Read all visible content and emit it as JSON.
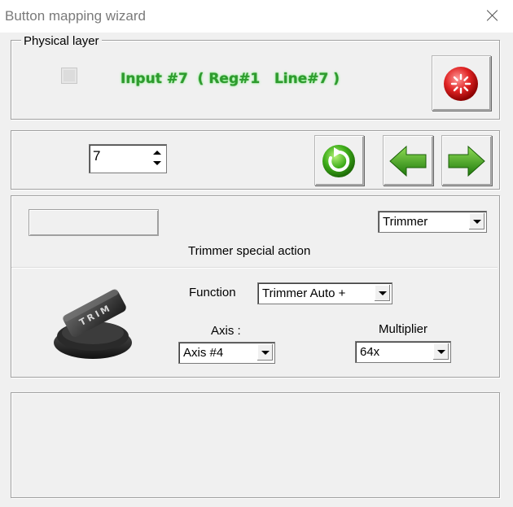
{
  "window": {
    "title": "Button mapping wizard"
  },
  "physical_layer": {
    "legend": "Physical layer",
    "input_status": "Input #7  ( Reg#1   Line#7 )",
    "stop_icon": "red-stop-icon"
  },
  "navigation": {
    "spin_value": "7",
    "refresh_icon": "green-refresh-icon",
    "prev_icon": "green-left-arrow-icon",
    "next_icon": "green-right-arrow-icon"
  },
  "action": {
    "type_value": "Trimmer",
    "caption": "Trimmer special action",
    "function_label": "Function",
    "function_value": "Trimmer Auto +",
    "axis_label": "Axis :",
    "axis_value": "Axis #4",
    "multiplier_label": "Multiplier",
    "multiplier_value": "64x",
    "knob_text": "TRIM",
    "image_icon": "trim-knob-icon"
  },
  "colors": {
    "accent_green": "#2e9b2e",
    "stop_red": "#d42020"
  }
}
